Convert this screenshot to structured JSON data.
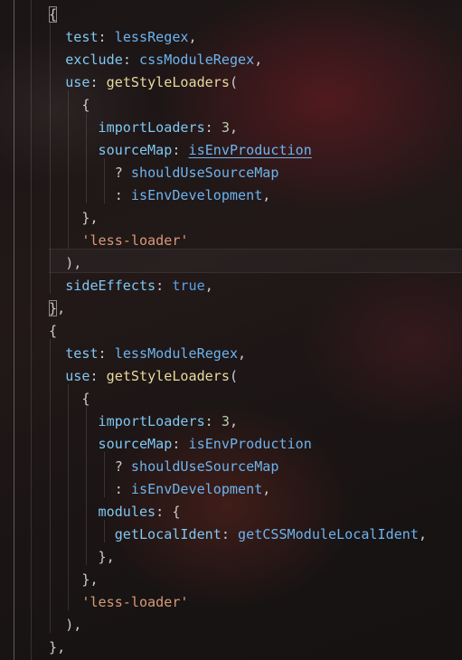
{
  "editor": {
    "lines": [
      {
        "tokens": [
          {
            "t": "{",
            "c": "pun",
            "box": true
          }
        ]
      },
      {
        "tokens": [
          {
            "t": "  "
          },
          {
            "t": "test",
            "c": "prop"
          },
          {
            "t": ": ",
            "c": "pun"
          },
          {
            "t": "lessRegex",
            "c": "var"
          },
          {
            "t": ",",
            "c": "pun"
          }
        ]
      },
      {
        "tokens": [
          {
            "t": "  "
          },
          {
            "t": "exclude",
            "c": "prop"
          },
          {
            "t": ": ",
            "c": "pun"
          },
          {
            "t": "cssModuleRegex",
            "c": "var"
          },
          {
            "t": ",",
            "c": "pun"
          }
        ]
      },
      {
        "tokens": [
          {
            "t": "  "
          },
          {
            "t": "use",
            "c": "prop"
          },
          {
            "t": ": ",
            "c": "pun"
          },
          {
            "t": "getStyleLoaders",
            "c": "fn"
          },
          {
            "t": "(",
            "c": "pun"
          }
        ]
      },
      {
        "tokens": [
          {
            "t": "    "
          },
          {
            "t": "{",
            "c": "pun"
          }
        ]
      },
      {
        "tokens": [
          {
            "t": "      "
          },
          {
            "t": "importLoaders",
            "c": "prop"
          },
          {
            "t": ": ",
            "c": "pun"
          },
          {
            "t": "3",
            "c": "num"
          },
          {
            "t": ",",
            "c": "pun"
          }
        ]
      },
      {
        "tokens": [
          {
            "t": "      "
          },
          {
            "t": "sourceMap",
            "c": "prop"
          },
          {
            "t": ": ",
            "c": "pun"
          },
          {
            "t": "isEnvProduction",
            "c": "var",
            "link": true
          }
        ]
      },
      {
        "tokens": [
          {
            "t": "        "
          },
          {
            "t": "? ",
            "c": "pun"
          },
          {
            "t": "shouldUseSourceMap",
            "c": "var"
          }
        ]
      },
      {
        "tokens": [
          {
            "t": "        "
          },
          {
            "t": ": ",
            "c": "pun"
          },
          {
            "t": "isEnvDevelopment",
            "c": "var"
          },
          {
            "t": ",",
            "c": "pun"
          }
        ]
      },
      {
        "tokens": [
          {
            "t": "    "
          },
          {
            "t": "},",
            "c": "pun"
          }
        ]
      },
      {
        "tokens": [
          {
            "t": "    "
          },
          {
            "t": "'less-loader'",
            "c": "str"
          }
        ]
      },
      {
        "tokens": [
          {
            "t": "  "
          },
          {
            "t": "),",
            "c": "pun"
          }
        ]
      },
      {
        "tokens": [
          {
            "t": "  "
          },
          {
            "t": "sideEffects",
            "c": "prop"
          },
          {
            "t": ": ",
            "c": "pun"
          },
          {
            "t": "true",
            "c": "kw"
          },
          {
            "t": ",",
            "c": "pun"
          }
        ]
      },
      {
        "tokens": [
          {
            "t": "}",
            "c": "pun",
            "box": true
          },
          {
            "t": ",",
            "c": "pun"
          }
        ]
      },
      {
        "tokens": [
          {
            "t": "{",
            "c": "pun"
          }
        ]
      },
      {
        "tokens": [
          {
            "t": "  "
          },
          {
            "t": "test",
            "c": "prop"
          },
          {
            "t": ": ",
            "c": "pun"
          },
          {
            "t": "lessModuleRegex",
            "c": "var"
          },
          {
            "t": ",",
            "c": "pun"
          }
        ]
      },
      {
        "tokens": [
          {
            "t": "  "
          },
          {
            "t": "use",
            "c": "prop"
          },
          {
            "t": ": ",
            "c": "pun"
          },
          {
            "t": "getStyleLoaders",
            "c": "fn"
          },
          {
            "t": "(",
            "c": "pun"
          }
        ]
      },
      {
        "tokens": [
          {
            "t": "    "
          },
          {
            "t": "{",
            "c": "pun"
          }
        ]
      },
      {
        "tokens": [
          {
            "t": "      "
          },
          {
            "t": "importLoaders",
            "c": "prop"
          },
          {
            "t": ": ",
            "c": "pun"
          },
          {
            "t": "3",
            "c": "num"
          },
          {
            "t": ",",
            "c": "pun"
          }
        ]
      },
      {
        "tokens": [
          {
            "t": "      "
          },
          {
            "t": "sourceMap",
            "c": "prop"
          },
          {
            "t": ": ",
            "c": "pun"
          },
          {
            "t": "isEnvProduction",
            "c": "var"
          }
        ]
      },
      {
        "tokens": [
          {
            "t": "        "
          },
          {
            "t": "? ",
            "c": "pun"
          },
          {
            "t": "shouldUseSourceMap",
            "c": "var"
          }
        ]
      },
      {
        "tokens": [
          {
            "t": "        "
          },
          {
            "t": ": ",
            "c": "pun"
          },
          {
            "t": "isEnvDevelopment",
            "c": "var"
          },
          {
            "t": ",",
            "c": "pun"
          }
        ]
      },
      {
        "tokens": [
          {
            "t": "      "
          },
          {
            "t": "modules",
            "c": "prop"
          },
          {
            "t": ": ",
            "c": "pun"
          },
          {
            "t": "{",
            "c": "pun"
          }
        ]
      },
      {
        "tokens": [
          {
            "t": "        "
          },
          {
            "t": "getLocalIdent",
            "c": "prop"
          },
          {
            "t": ": ",
            "c": "pun"
          },
          {
            "t": "getCSSModuleLocalIdent",
            "c": "var"
          },
          {
            "t": ",",
            "c": "pun"
          }
        ]
      },
      {
        "tokens": [
          {
            "t": "      "
          },
          {
            "t": "},",
            "c": "pun"
          }
        ]
      },
      {
        "tokens": [
          {
            "t": "    "
          },
          {
            "t": "},",
            "c": "pun"
          }
        ]
      },
      {
        "tokens": [
          {
            "t": "    "
          },
          {
            "t": "'less-loader'",
            "c": "str"
          }
        ]
      },
      {
        "tokens": [
          {
            "t": "  "
          },
          {
            "t": "),",
            "c": "pun"
          }
        ]
      },
      {
        "tokens": [
          {
            "t": "},",
            "c": "pun"
          }
        ]
      }
    ]
  }
}
